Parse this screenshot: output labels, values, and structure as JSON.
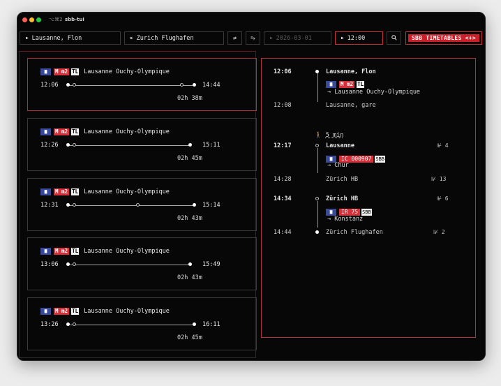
{
  "window": {
    "shortcut": "⌥⌘2",
    "title": "sbb-tui"
  },
  "search": {
    "from": "Lausanne, Flon",
    "to": "Zurich Flughafen",
    "swap_icon": "⇄",
    "departure_mode_icon": "⥱",
    "date": "2026-03-01",
    "time": "12:00",
    "search_icon": "🔍",
    "brand_label": "SBB TIMETABLES <+>"
  },
  "colors": {
    "accent": "#cc1f2a",
    "bus_badge": "#3a4a9a",
    "border": "#3a3a3a"
  },
  "connections": [
    {
      "mode_icon": "bus-icon",
      "line": "M m2",
      "operator": "TL",
      "destination": "Lausanne Ouchy-Olympique",
      "departure": "12:06",
      "arrival": "14:44",
      "duration": "02h 38m",
      "selected": true
    },
    {
      "mode_icon": "bus-icon",
      "line": "M m2",
      "operator": "TL",
      "destination": "Lausanne Ouchy-Olympique",
      "departure": "12:26",
      "arrival": "15:11",
      "duration": "02h 45m",
      "selected": false
    },
    {
      "mode_icon": "bus-icon",
      "line": "M m2",
      "operator": "TL",
      "destination": "Lausanne Ouchy-Olympique",
      "departure": "12:31",
      "arrival": "15:14",
      "duration": "02h 43m",
      "selected": false
    },
    {
      "mode_icon": "bus-icon",
      "line": "M m2",
      "operator": "TL",
      "destination": "Lausanne Ouchy-Olympique",
      "departure": "13:06",
      "arrival": "15:49",
      "duration": "02h 43m",
      "selected": false
    },
    {
      "mode_icon": "bus-icon",
      "line": "M m2",
      "operator": "TL",
      "destination": "Lausanne Ouchy-Olympique",
      "departure": "13:26",
      "arrival": "16:11",
      "duration": "02h 45m",
      "selected": false
    }
  ],
  "detail": {
    "leg1": {
      "dep_time": "12:06",
      "dep_stop": "Lausanne, Flon",
      "line": "M m2",
      "operator": "TL",
      "direction": "→ Lausanne Ouchy-Olympique",
      "arr_time": "12:08",
      "arr_stop": "Lausanne, gare"
    },
    "walk": {
      "icon": "🚶",
      "text": "5 min"
    },
    "leg2": {
      "dep_time": "12:17",
      "dep_stop": "Lausanne",
      "dep_platform": "⊮ 4",
      "line": "IC 000907",
      "operator": "SBB",
      "direction": "→ Chur",
      "arr_time": "14:28",
      "arr_stop": "Zürich HB",
      "arr_platform": "⊮ 13"
    },
    "leg3": {
      "dep_time": "14:34",
      "dep_stop": "Zürich HB",
      "dep_platform": "⊮ 6",
      "line": "IR 75",
      "operator": "SBB",
      "direction": "→ Konstanz",
      "arr_time": "14:44",
      "arr_stop": "Zürich Flughafen",
      "arr_platform": "⊮ 2"
    }
  }
}
